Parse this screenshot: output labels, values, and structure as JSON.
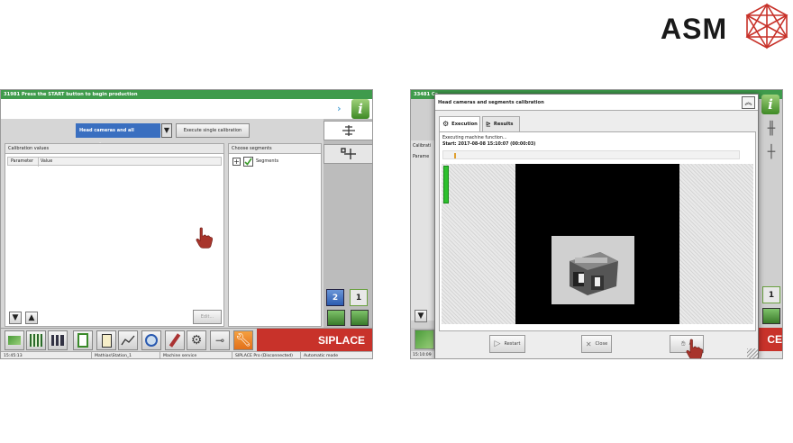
{
  "brand": {
    "logo_text": "ASM",
    "emblem": "asm-emblem-icon",
    "emblem_color": "#c8322a"
  },
  "left_screen": {
    "status_message": "31981 Press the START button to begin production",
    "calibration_mode": "Head cameras and all segments",
    "execute_button": "Execute single calibration",
    "calibration_values_title": "Calibration values",
    "columns": [
      "Parameter",
      "Value"
    ],
    "choose_segments_title": "Choose segments",
    "segments_node": "Segments",
    "edit_button": "Edit...",
    "gantry_buttons": [
      "2",
      "1"
    ],
    "brand_banner": "SIPLACE",
    "status_bar": {
      "time": "15:45:13",
      "station": "Mathias\\Station_1",
      "role": "Machine service",
      "connection": "SIPLACE Pro (Disconnected)",
      "mode": "Automatic mode"
    }
  },
  "right_screen": {
    "status_message_partial": "33481 Ca",
    "dialog_title": "Head cameras and segments calibration",
    "tabs": [
      "Execution",
      "Results"
    ],
    "executing_text": "Executing machine function...",
    "start_text": "Start: 2017-08-08 15:10:07 (00:00:03)",
    "buttons": {
      "restart": "Restart",
      "close": "Close",
      "abort_partial": "A"
    },
    "background_partial": {
      "calib": "Calibrati",
      "param": "Parame",
      "banner": "CE",
      "time": "15:10:09"
    },
    "gantry_button": "1",
    "accent_green": "#2ec02e"
  },
  "colors": {
    "siplace_red": "#c8322a",
    "top_green": "#3f9b4c",
    "dropdown_blue": "#3a6fc0"
  }
}
